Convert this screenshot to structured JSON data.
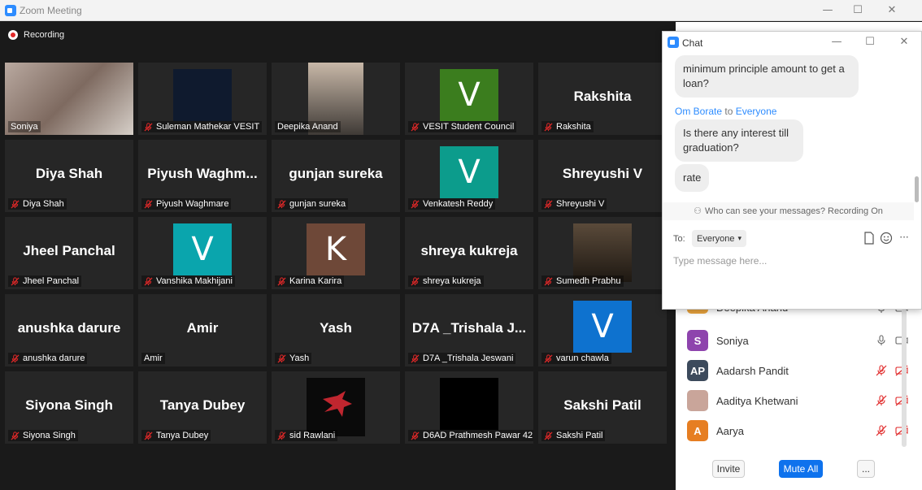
{
  "window": {
    "title": "Zoom Meeting",
    "minimize": "—",
    "maximize": "☐",
    "close": "✕"
  },
  "recording": {
    "label": "Recording"
  },
  "colors": {
    "active_border": "#d8e85e",
    "green_avatar": "#3b7d1e",
    "teal_avatar": "#0c9c8c",
    "cyan_avatar": "#0aa5ad",
    "brown_avatar": "#6e4838",
    "blue_avatar": "#0e72cf",
    "accent": "#2d8cff",
    "muted_red": "#e02828"
  },
  "tiles": [
    {
      "label": "Soniya",
      "big": "",
      "muted": false,
      "kind": "video"
    },
    {
      "label": "Suleman Mathekar VESIT",
      "big": "",
      "muted": true,
      "kind": "dark-video"
    },
    {
      "label": "Deepika Anand",
      "big": "",
      "muted": false,
      "kind": "video"
    },
    {
      "label": "VESIT Student Council",
      "big": "V",
      "muted": true,
      "kind": "avatar"
    },
    {
      "label": "Rakshita",
      "big": "Rakshita",
      "muted": true,
      "kind": "name"
    },
    {
      "label": "Diya Shah",
      "big": "Diya Shah",
      "muted": true,
      "kind": "name"
    },
    {
      "label": "Piyush Waghmare",
      "big": "Piyush  Waghm...",
      "muted": true,
      "kind": "name"
    },
    {
      "label": "gunjan sureka",
      "big": "gunjan sureka",
      "muted": true,
      "kind": "name"
    },
    {
      "label": "Venkatesh Reddy",
      "big": "V",
      "muted": true,
      "kind": "avatar"
    },
    {
      "label": "Shreyushi V",
      "big": "Shreyushi V",
      "muted": true,
      "kind": "name"
    },
    {
      "label": "Jheel Panchal",
      "big": "Jheel Panchal",
      "muted": true,
      "kind": "name"
    },
    {
      "label": "Vanshika Makhijani",
      "big": "V",
      "muted": true,
      "kind": "avatar"
    },
    {
      "label": "Karina Karira",
      "big": "K",
      "muted": true,
      "kind": "avatar"
    },
    {
      "label": "shreya kukreja",
      "big": "shreya kukreja",
      "muted": true,
      "kind": "name"
    },
    {
      "label": "Sumedh Prabhu",
      "big": "",
      "muted": true,
      "kind": "video"
    },
    {
      "label": "anushka darure",
      "big": "anushka darure",
      "muted": true,
      "kind": "name"
    },
    {
      "label": "Amir",
      "big": "Amir",
      "muted": false,
      "kind": "name"
    },
    {
      "label": "Yash",
      "big": "Yash",
      "muted": true,
      "kind": "name"
    },
    {
      "label": "D7A _Trishala Jeswani",
      "big": "D7A _Trishala J...",
      "muted": true,
      "kind": "name"
    },
    {
      "label": "varun chawla",
      "big": "V",
      "muted": true,
      "kind": "avatar"
    },
    {
      "label": "Siyona Singh",
      "big": "Siyona Singh",
      "muted": true,
      "kind": "name"
    },
    {
      "label": "Tanya Dubey",
      "big": "Tanya Dubey",
      "muted": true,
      "kind": "name"
    },
    {
      "label": "sid Rawlani",
      "big": "",
      "muted": true,
      "kind": "logo"
    },
    {
      "label": "D6AD Prathmesh Pawar 42",
      "big": "",
      "muted": true,
      "kind": "black"
    },
    {
      "label": "Sakshi Patil",
      "big": "Sakshi Patil",
      "muted": true,
      "kind": "name"
    }
  ],
  "participants": [
    {
      "initials": "DA",
      "name": "Deepika Anand",
      "color": "#e8a33d",
      "muted": false
    },
    {
      "initials": "S",
      "name": "Soniya",
      "color": "#8e44ad",
      "muted": false
    },
    {
      "initials": "AP",
      "name": "Aadarsh Pandit",
      "color": "#3c4a5c",
      "muted": true
    },
    {
      "initials": "",
      "name": "Aaditya Khetwani",
      "color": "#c9a59a",
      "muted": true
    },
    {
      "initials": "A",
      "name": "Aarya",
      "color": "#e67e22",
      "muted": true
    }
  ],
  "participant_buttons": {
    "invite": "Invite",
    "mute_all": "Mute All",
    "more": "..."
  },
  "chat": {
    "title": "Chat",
    "messages": [
      {
        "text": "minimum principle amount to get a loan?"
      },
      {
        "sender": "Om Borate",
        "to_word": "to",
        "recipient": "Everyone"
      },
      {
        "text": "Is there any interest till graduation?"
      },
      {
        "text": "rate"
      }
    ],
    "privacy_note": "Who can see your messages? Recording On",
    "to_label": "To:",
    "to_value": "Everyone",
    "input_placeholder": "Type message here...",
    "more": "···"
  }
}
